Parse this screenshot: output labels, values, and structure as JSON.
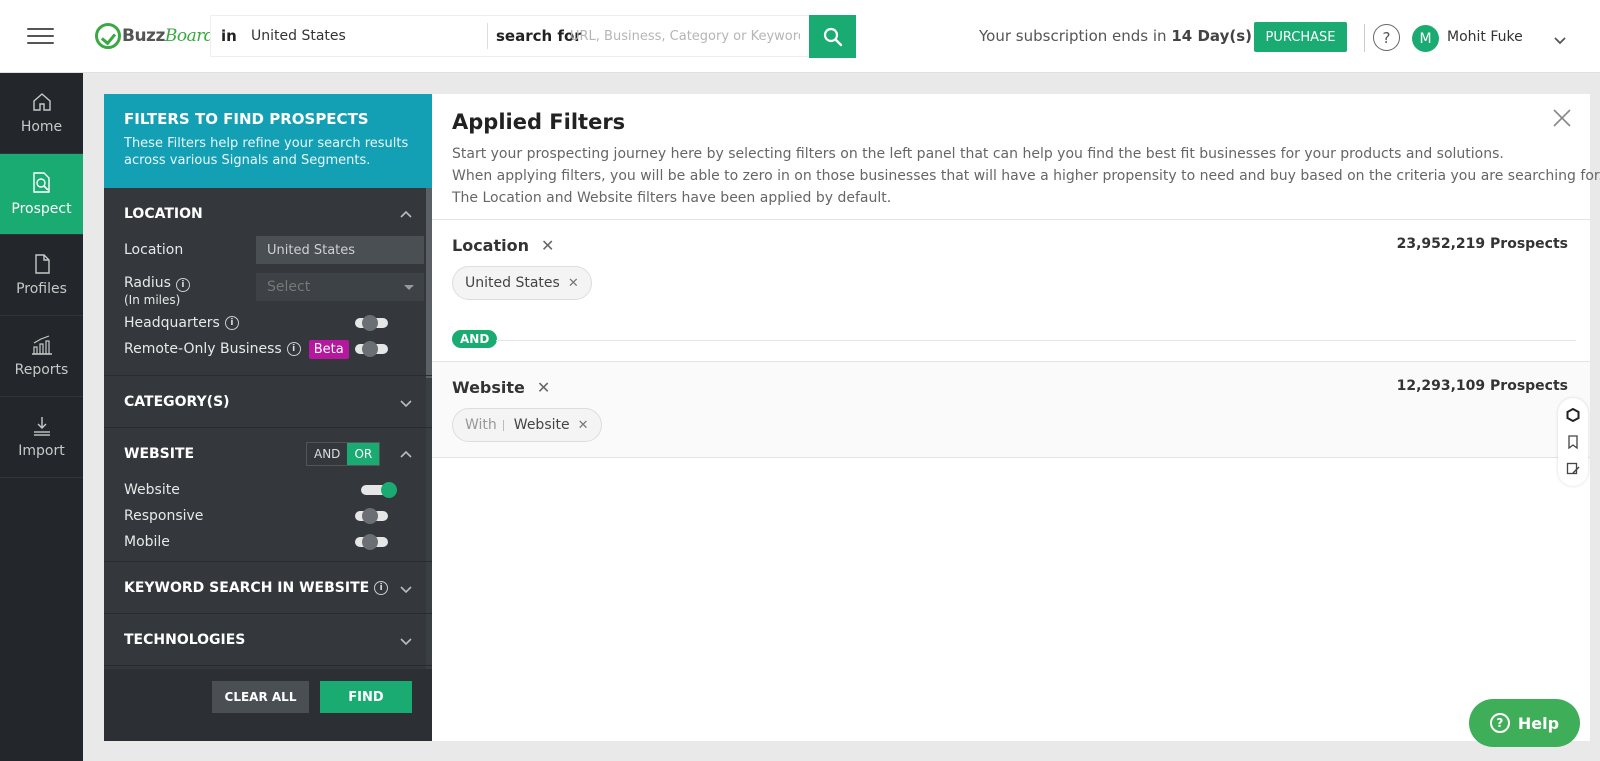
{
  "header": {
    "logo": {
      "part1": "Buzz",
      "part2": "Board"
    },
    "search": {
      "in_label": "in",
      "location": "United States",
      "for_label": "search for",
      "placeholder": "URL, Business, Category or Keyword"
    },
    "subscription_prefix": "Your subscription ends in",
    "subscription_days": "14 Day(s)",
    "purchase_label": "PURCHASE",
    "help_label": "?",
    "avatar_initial": "M",
    "user_name": "Mohit Fuke"
  },
  "nav": {
    "items": [
      {
        "label": "Home",
        "icon": "home-icon"
      },
      {
        "label": "Prospect",
        "icon": "prospect-icon",
        "active": true
      },
      {
        "label": "Profiles",
        "icon": "document-icon"
      },
      {
        "label": "Reports",
        "icon": "chart-icon"
      },
      {
        "label": "Import",
        "icon": "import-icon"
      }
    ]
  },
  "filters": {
    "title": "FILTERS TO FIND PROSPECTS",
    "subtitle": "These Filters help refine your search results across various Signals and Segments.",
    "location": {
      "title": "LOCATION",
      "location_label": "Location",
      "location_value": "United States",
      "radius_label": "Radius",
      "radius_unit": "(In miles)",
      "radius_placeholder": "Select",
      "headquarters_label": "Headquarters",
      "remote_label": "Remote-Only Business",
      "beta_label": "Beta"
    },
    "categories_title": "CATEGORY(S)",
    "website": {
      "title": "WEBSITE",
      "and_label": "AND",
      "or_label": "OR",
      "website_label": "Website",
      "responsive_label": "Responsive",
      "mobile_label": "Mobile"
    },
    "keyword_title": "KEYWORD SEARCH IN WEBSITE",
    "technologies_title": "TECHNOLOGIES",
    "clear_label": "CLEAR ALL",
    "find_label": "FIND"
  },
  "applied": {
    "title": "Applied Filters",
    "desc_line1": "Start your prospecting journey here by selecting filters on the left panel that can help you find the best fit businesses for your products and solutions.",
    "desc_line2": "When applying filters, you will be able to zero in on those businesses that will have a higher propensity to need and buy based on the criteria you are searching for.",
    "desc_line3": "The Location and Website filters have been applied by default.",
    "location_block": {
      "title": "Location",
      "count": "23,952,219 Prospects",
      "chip": "United States"
    },
    "and_label": "AND",
    "website_block": {
      "title": "Website",
      "count": "12,293,109 Prospects",
      "chip_prefix": "With",
      "chip_value": "Website"
    }
  },
  "help_button_label": "Help",
  "colors": {
    "brand_green": "#1aab73",
    "filters_head": "#13a0b5",
    "beta": "#b5179e"
  }
}
